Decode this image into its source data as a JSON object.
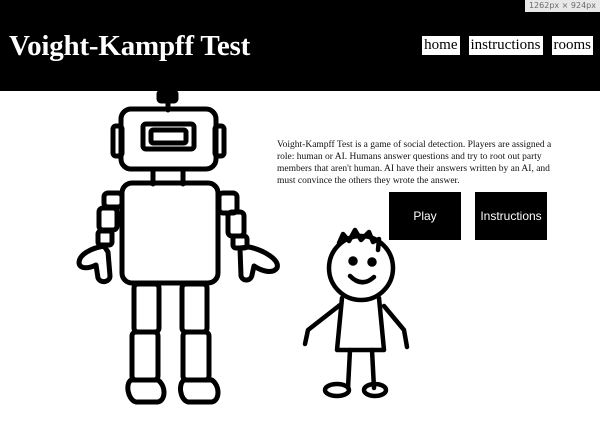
{
  "devtools": {
    "size_badge": "1262px × 924px"
  },
  "header": {
    "title": "Voight-Kampff Test",
    "nav": [
      {
        "label": "home"
      },
      {
        "label": "instructions"
      },
      {
        "label": "rooms"
      }
    ]
  },
  "main": {
    "description": "Voight-Kampff Test is a game of social detection. Players are assigned a role: human or AI. Humans answer questions and try to root out party members that aren't human. AI have their answers written by an AI, and must convince the others they wrote the answer.",
    "buttons": {
      "play": "Play",
      "instructions": "Instructions"
    }
  },
  "illustration": {
    "figures": [
      "robot",
      "stick-figure-child"
    ]
  }
}
